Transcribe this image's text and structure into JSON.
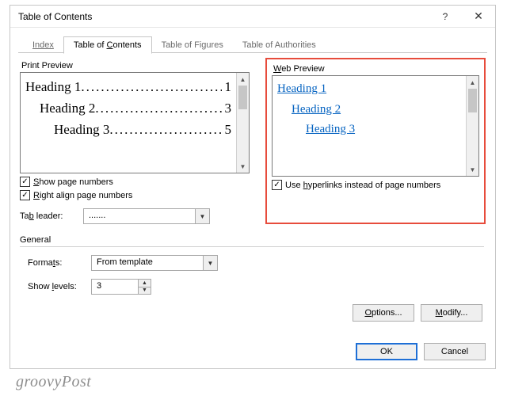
{
  "title": "Table of Contents",
  "tabs": {
    "index": "Index",
    "toc_pre": "Table of ",
    "toc_ul": "C",
    "toc_post": "ontents",
    "tof": "Table of Figures",
    "toa": "Table of Authorities"
  },
  "print": {
    "label": "Print Preview",
    "h1_text": "Heading 1",
    "h1_page": "1",
    "h2_text": "Heading 2",
    "h2_page": "3",
    "h3_text": "Heading 3",
    "h3_page": "5",
    "dots": "..............................."
  },
  "web": {
    "label_ul": "W",
    "label_rest": "eb Preview",
    "h1": "Heading 1",
    "h2": "Heading 2",
    "h3": "Heading 3"
  },
  "opts": {
    "show_pre": "",
    "show_ul": "S",
    "show_post": "how page numbers",
    "right_ul": "R",
    "right_post": "ight align page numbers",
    "hyper_pre": "Use ",
    "hyper_ul": "h",
    "hyper_post": "yperlinks instead of page numbers",
    "tab_pre": "Ta",
    "tab_ul": "b",
    "tab_post": " leader:",
    "tab_value": "......."
  },
  "general": {
    "header": "General",
    "formats_pre": "Forma",
    "formats_ul": "t",
    "formats_post": "s:",
    "formats_value": "From template",
    "levels_pre": "Show ",
    "levels_ul": "l",
    "levels_post": "evels:",
    "levels_value": "3"
  },
  "buttons": {
    "options_ul": "O",
    "options_post": "ptions...",
    "modify_ul": "M",
    "modify_post": "odify...",
    "ok": "OK",
    "cancel": "Cancel"
  },
  "watermark": "groovyPost"
}
